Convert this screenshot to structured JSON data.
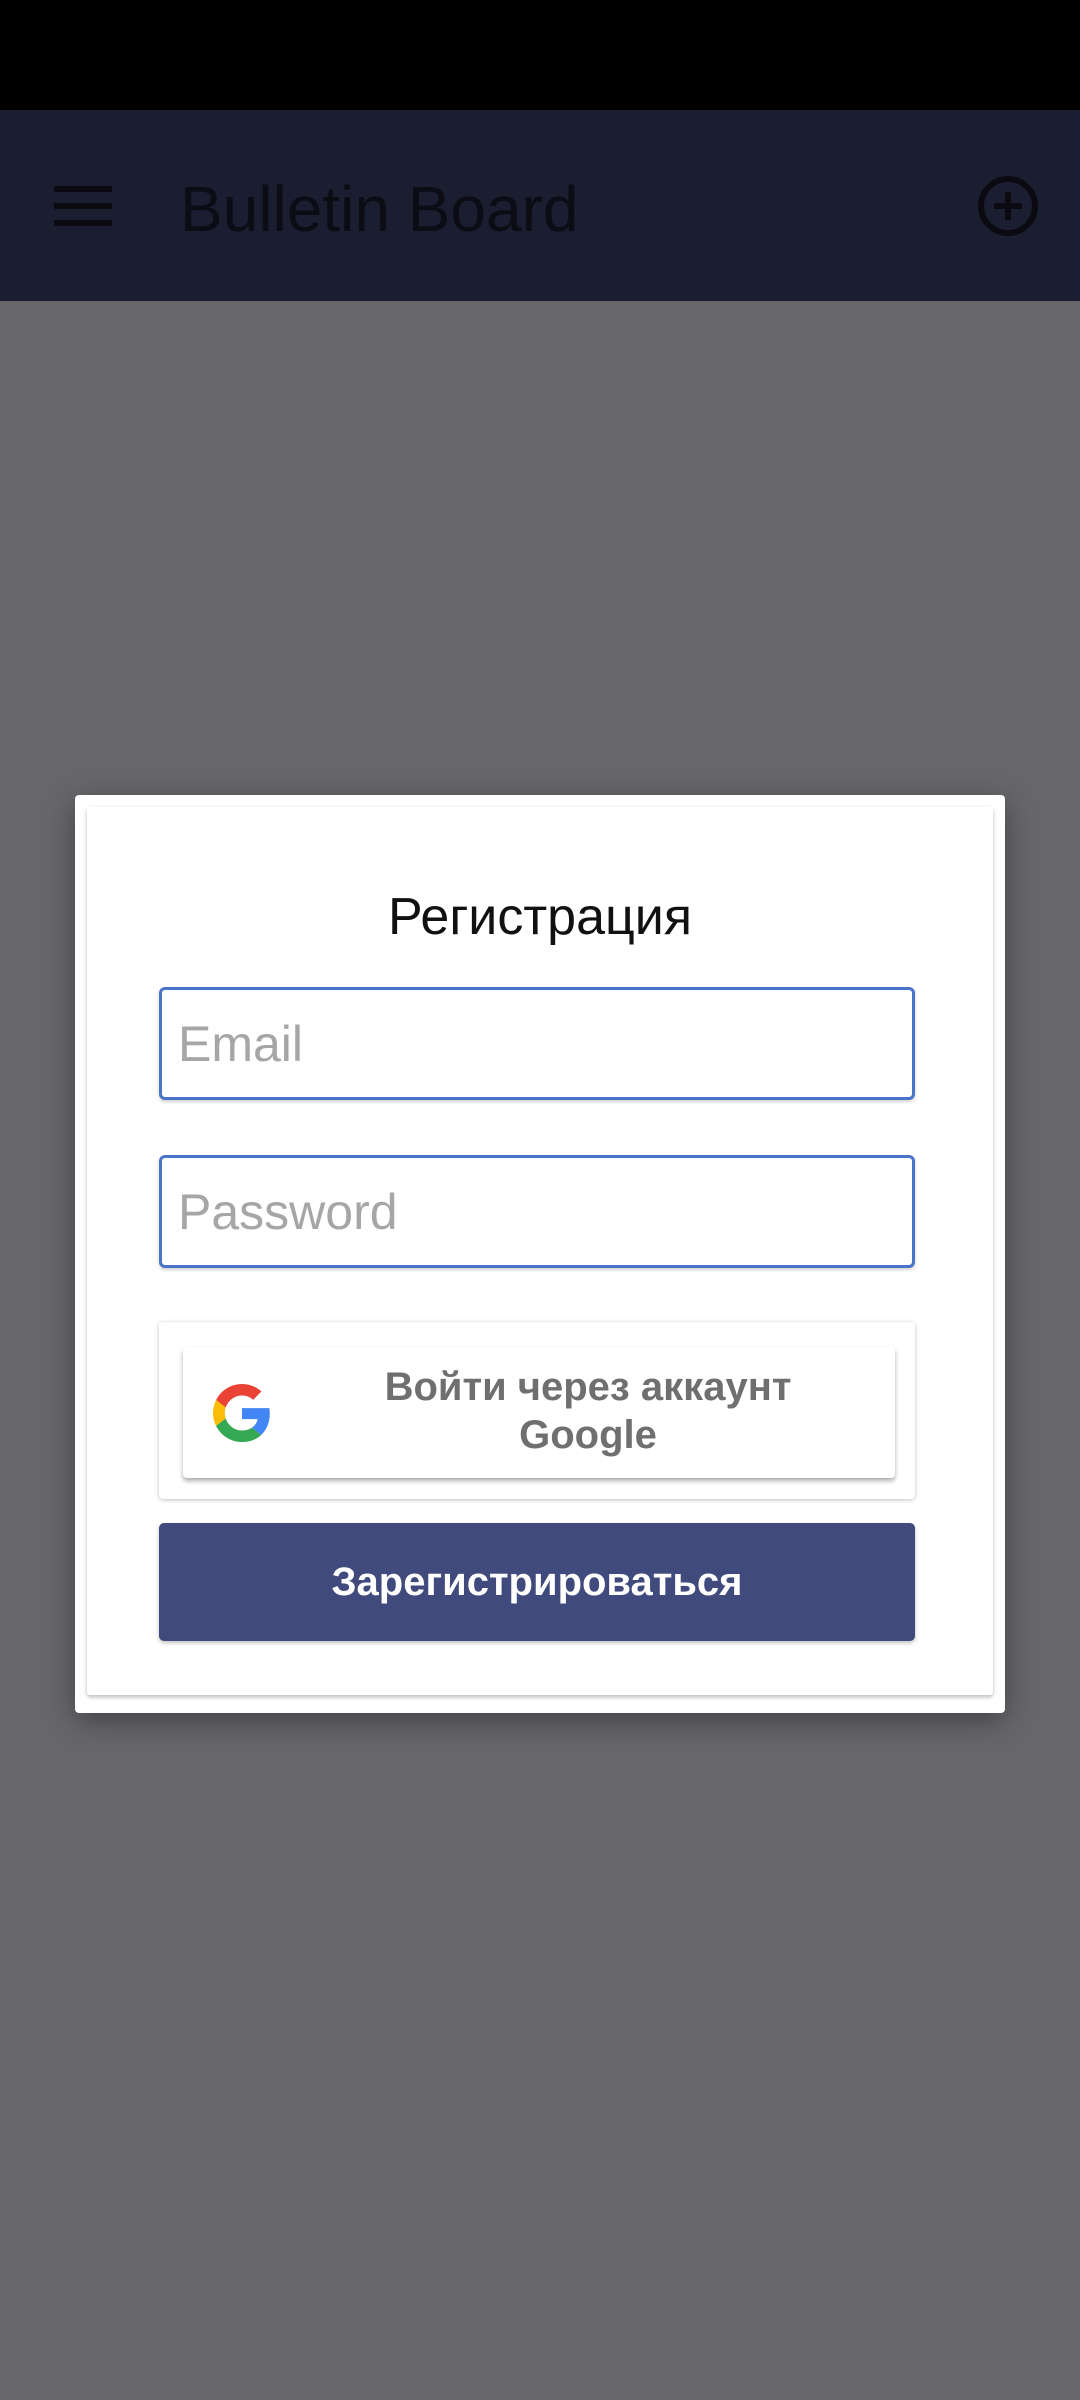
{
  "app_bar": {
    "title": "Bulletin Board",
    "menu_icon": "hamburger-menu-icon",
    "action_icon": "add-circle-icon",
    "color": "#1b1d31"
  },
  "dialog": {
    "title": "Регистрация",
    "email": {
      "value": "",
      "placeholder": "Email"
    },
    "password": {
      "value": "",
      "placeholder": "Password"
    },
    "google_button": {
      "label": "Войти через аккаунт Google",
      "icon": "google-icon"
    },
    "register_button": {
      "label": "Зарегистрироваться",
      "color": "#414a7c"
    }
  },
  "colors": {
    "scrim": "#67666a",
    "field_border": "#4a74c7"
  }
}
